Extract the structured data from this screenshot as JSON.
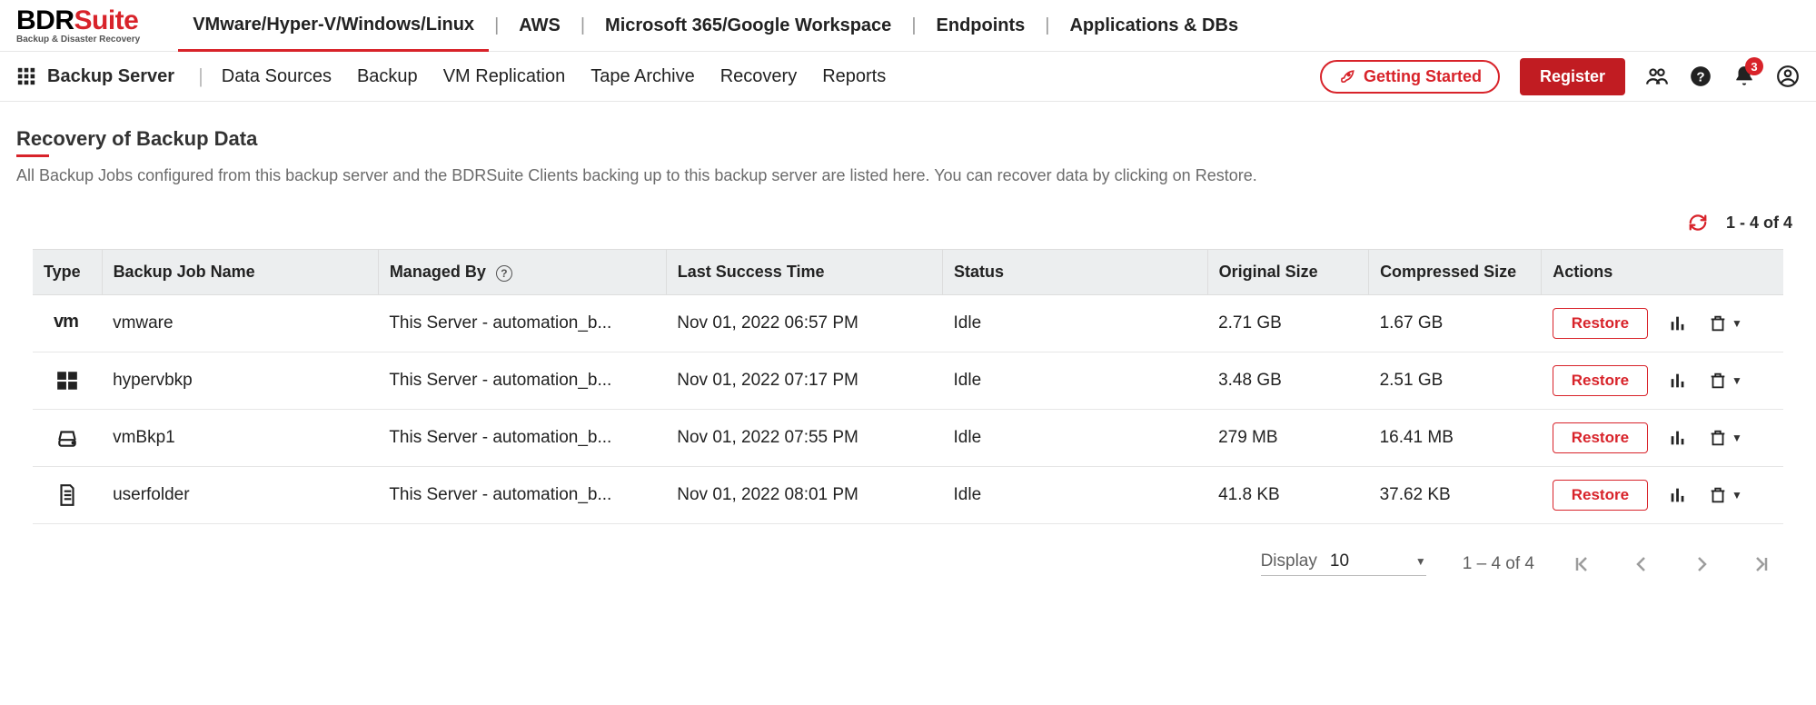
{
  "brand": {
    "name_a": "BDR",
    "name_b": "Suite",
    "tagline": "Backup & Disaster Recovery"
  },
  "top_tabs": [
    {
      "label": "VMware/Hyper-V/Windows/Linux",
      "active": true
    },
    {
      "label": "AWS",
      "active": false
    },
    {
      "label": "Microsoft 365/Google Workspace",
      "active": false
    },
    {
      "label": "Endpoints",
      "active": false
    },
    {
      "label": "Applications & DBs",
      "active": false
    }
  ],
  "nav": {
    "title": "Backup Server",
    "links": [
      "Data Sources",
      "Backup",
      "VM Replication",
      "Tape Archive",
      "Recovery",
      "Reports"
    ],
    "getting_started": "Getting Started",
    "register": "Register",
    "bell_badge": "3"
  },
  "page": {
    "title": "Recovery of Backup Data",
    "description": "All Backup Jobs configured from this backup server and the BDRSuite Clients backing up to this backup server are listed here. You can recover data by clicking on Restore.",
    "range_top": "1 - 4 of 4"
  },
  "table": {
    "headers": {
      "type": "Type",
      "name": "Backup Job Name",
      "managed": "Managed By",
      "last": "Last Success Time",
      "status": "Status",
      "orig": "Original Size",
      "comp": "Compressed Size",
      "actions": "Actions"
    },
    "restore_label": "Restore",
    "rows": [
      {
        "type": "vmware",
        "name": "vmware",
        "managed": "This Server - automation_b...",
        "last": "Nov 01, 2022 06:57 PM",
        "status": "Idle",
        "orig": "2.71 GB",
        "comp": "1.67 GB"
      },
      {
        "type": "windows",
        "name": "hypervbkp",
        "managed": "This Server - automation_b...",
        "last": "Nov 01, 2022 07:17 PM",
        "status": "Idle",
        "orig": "3.48 GB",
        "comp": "2.51 GB"
      },
      {
        "type": "disk",
        "name": "vmBkp1",
        "managed": "This Server - automation_b...",
        "last": "Nov 01, 2022 07:55 PM",
        "status": "Idle",
        "orig": "279 MB",
        "comp": "16.41 MB"
      },
      {
        "type": "file",
        "name": "userfolder",
        "managed": "This Server - automation_b...",
        "last": "Nov 01, 2022 08:01 PM",
        "status": "Idle",
        "orig": "41.8 KB",
        "comp": "37.62 KB"
      }
    ]
  },
  "paginator": {
    "display_label": "Display",
    "display_value": "10",
    "range": "1 – 4 of 4"
  }
}
